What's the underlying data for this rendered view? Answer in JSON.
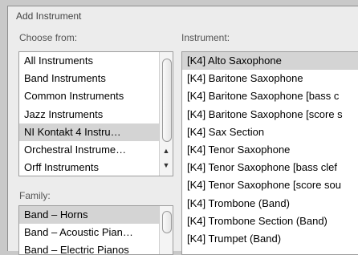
{
  "title": "Add Instrument",
  "choose_from": {
    "label": "Choose from:",
    "items": [
      "All Instruments",
      "Band Instruments",
      "Common Instruments",
      "Jazz Instruments",
      "NI Kontakt 4 Instru…",
      "Orchestral Instrume…",
      "Orff Instruments"
    ],
    "selected_index": 4
  },
  "family": {
    "label": "Family:",
    "items": [
      "Band – Horns",
      "Band – Acoustic Pian…",
      "Band – Electric Pianos"
    ],
    "selected_index": 0
  },
  "instrument": {
    "label": "Instrument:",
    "items": [
      "[K4] Alto Saxophone",
      "[K4] Baritone Saxophone",
      "[K4] Baritone Saxophone [bass c",
      "[K4] Baritone Saxophone [score s",
      "[K4] Sax Section",
      "[K4] Tenor Saxophone",
      "[K4] Tenor Saxophone [bass clef",
      "[K4] Tenor Saxophone [score sou",
      "[K4] Trombone (Band)",
      "[K4] Trombone Section (Band)",
      "[K4] Trumpet (Band)"
    ],
    "selected_index": 0
  },
  "scroll_arrows": {
    "up_icon": "▲",
    "down_icon": "▼"
  }
}
